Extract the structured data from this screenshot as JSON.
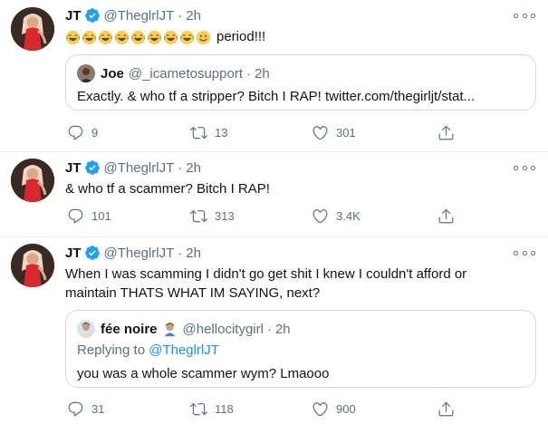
{
  "tweets": [
    {
      "name": "JT",
      "handle": "@TheglrlJT",
      "separator": "·",
      "time": "2h",
      "emoji_count": 8,
      "text": "period!!!",
      "quote": {
        "name": "Joe",
        "handle": "@_icametosupport",
        "separator": "·",
        "time": "2h",
        "text": "Exactly. & who tf a stripper? Bitch I RAP! twitter.com/thegirljt/stat..."
      },
      "actions": {
        "replies": "9",
        "retweets": "13",
        "likes": "301"
      }
    },
    {
      "name": "JT",
      "handle": "@TheglrlJT",
      "separator": "·",
      "time": "2h",
      "text": "& who tf a scammer? Bitch I RAP!",
      "actions": {
        "replies": "101",
        "retweets": "313",
        "likes": "3.4K"
      }
    },
    {
      "name": "JT",
      "handle": "@TheglrlJT",
      "separator": "·",
      "time": "2h",
      "text_line1": "When I was scamming I didn't go get shit I knew I couldn't afford or",
      "text_line2": "maintain THATS WHAT IM SAYING, next?",
      "quote": {
        "name": "fée noire",
        "handle": "@hellocitygirl",
        "separator": "·",
        "time": "2h",
        "replying_prefix": "Replying to",
        "replying_handle": "@TheglrlJT",
        "text": "you was a whole scammer wym? Lmaooo"
      },
      "actions": {
        "replies": "31",
        "retweets": "118",
        "likes": "900"
      }
    }
  ],
  "colors": {
    "accent": "#1da1f2",
    "muted": "#5b7083",
    "border": "#cfd9de"
  }
}
